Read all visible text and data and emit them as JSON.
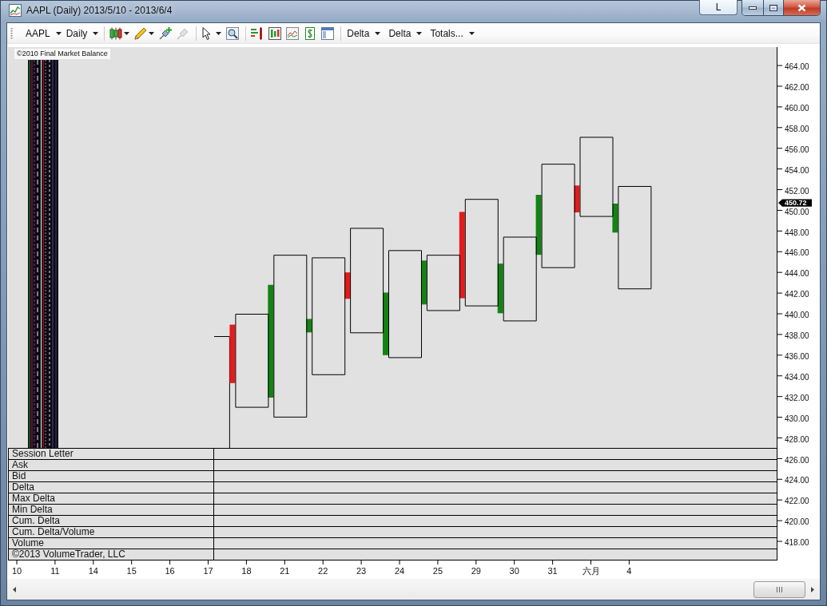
{
  "window": {
    "title": "AAPL (Daily) 2013/5/10 - 2013/6/4",
    "title_button": "L"
  },
  "toolbar": {
    "symbol": "AAPL",
    "interval": "Daily",
    "tool_groups": [
      [
        {
          "dropdown": true,
          "disabled": false
        },
        {
          "dropdown": true,
          "disabled": false
        },
        {
          "dropdown": false,
          "disabled": false
        },
        {
          "dropdown": false,
          "disabled": true
        }
      ],
      [
        {
          "dropdown": true,
          "disabled": false
        },
        {
          "dropdown": false,
          "disabled": false
        }
      ],
      [
        {
          "dropdown": false,
          "disabled": false
        },
        {
          "dropdown": false,
          "disabled": false
        },
        {
          "dropdown": false,
          "disabled": false
        },
        {
          "dropdown": false,
          "disabled": false
        },
        {
          "dropdown": false,
          "disabled": false
        }
      ]
    ],
    "indicators": [
      "Delta",
      "Delta",
      "Totals..."
    ]
  },
  "chart": {
    "copyright": "©2010 Final Market Balance",
    "chart_data": {
      "type": "bar",
      "categories": [
        "10",
        "11",
        "14",
        "15",
        "16",
        "17",
        "18",
        "21",
        "22",
        "23",
        "24",
        "25",
        "29",
        "30",
        "31",
        "六月",
        "4",
        null,
        null,
        null
      ],
      "ylim": [
        416.15,
        465.78
      ],
      "yticks": [
        {
          "value": 464,
          "label": "464.00"
        },
        {
          "value": 462,
          "label": "462.00"
        },
        {
          "value": 460,
          "label": "460.00"
        },
        {
          "value": 458,
          "label": "458.00"
        },
        {
          "value": 456,
          "label": "456.00"
        },
        {
          "value": 454,
          "label": "454.00"
        },
        {
          "value": 452,
          "label": "452.00"
        },
        {
          "value": 450,
          "label": "450.00"
        },
        {
          "value": 448,
          "label": "448.00"
        },
        {
          "value": 446,
          "label": "446.00"
        },
        {
          "value": 444,
          "label": "444.00"
        },
        {
          "value": 442,
          "label": "442.00"
        },
        {
          "value": 440,
          "label": "440.00"
        },
        {
          "value": 438,
          "label": "438.00"
        },
        {
          "value": 436,
          "label": "436.00"
        },
        {
          "value": 434,
          "label": "434.00"
        },
        {
          "value": 432,
          "label": "432.00"
        },
        {
          "value": 430,
          "label": "430.00"
        },
        {
          "value": 428,
          "label": "428.00"
        },
        {
          "value": 426,
          "label": "426.00"
        },
        {
          "value": 424,
          "label": "424.00"
        },
        {
          "value": 422,
          "label": "422.00"
        },
        {
          "value": 420,
          "label": "420.00"
        },
        {
          "value": 418,
          "label": "418.00"
        }
      ],
      "annotations": [
        "450.72"
      ]
    }
  },
  "table": {
    "rows": [
      "Session Letter",
      "Ask",
      "Bid",
      "Delta",
      "Max Delta",
      "Min Delta",
      "Cum. Delta",
      "Cum. Delta/Volume",
      "Volume"
    ],
    "footer_note": "©2013 VolumeTrader, LLC"
  }
}
